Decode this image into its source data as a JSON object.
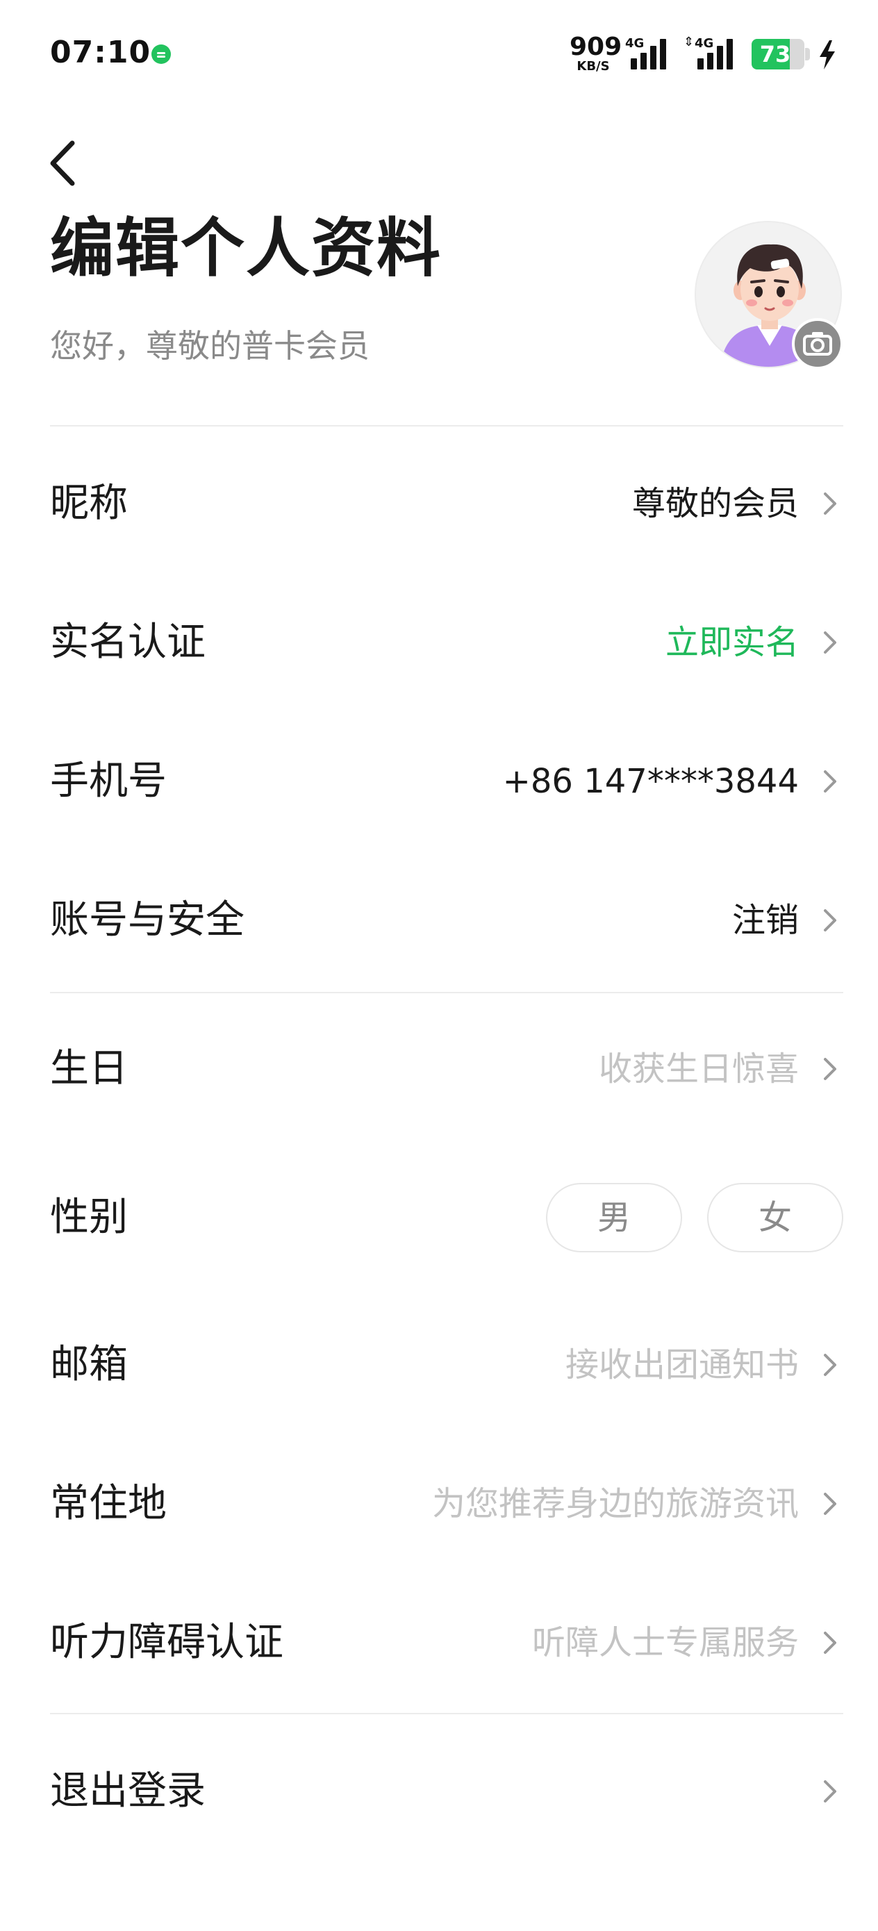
{
  "status_bar": {
    "time": "07:10",
    "net_speed_value": "909",
    "net_speed_unit": "KB/S",
    "signal_1_label": "4G",
    "signal_2_label": "4G",
    "battery_level": "73",
    "battery_fraction": 0.73,
    "accent_color": "#22c35e"
  },
  "header": {
    "title": "编辑个人资料",
    "subtitle": "您好，尊敬的普卡会员"
  },
  "profile_rows": [
    {
      "label": "昵称",
      "value": "尊敬的会员"
    },
    {
      "label": "实名认证",
      "value": "立即实名"
    },
    {
      "label": "手机号",
      "value": "+86 147****3844"
    },
    {
      "label": "账号与安全",
      "value": "注销"
    }
  ],
  "detail_rows": [
    {
      "label": "生日",
      "placeholder": "收获生日惊喜"
    },
    {
      "label": "性别",
      "options": [
        "男",
        "女"
      ]
    },
    {
      "label": "邮箱",
      "placeholder": "接收出团通知书"
    },
    {
      "label": "常住地",
      "placeholder": "为您推荐身边的旅游资讯"
    },
    {
      "label": "听力障碍认证",
      "placeholder": "听障人士专属服务"
    }
  ],
  "logout": {
    "label": "退出登录"
  },
  "colors": {
    "link_green": "#1fb85a",
    "placeholder_gray": "#c3c3c3",
    "subtitle_gray": "#8a8a8a"
  }
}
